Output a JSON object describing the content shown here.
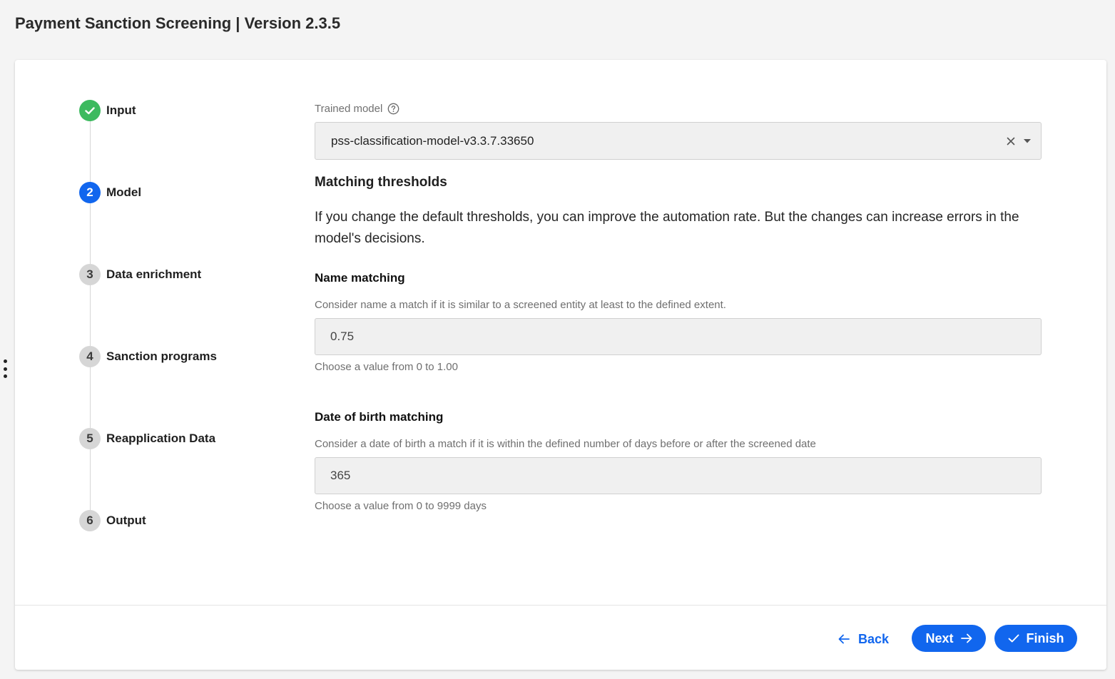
{
  "app": {
    "title": "Payment Sanction Screening | Version 2.3.5"
  },
  "steps": [
    {
      "marker": "",
      "label": "Input",
      "state": "done"
    },
    {
      "marker": "2",
      "label": "Model",
      "state": "current"
    },
    {
      "marker": "3",
      "label": "Data enrichment",
      "state": "pending"
    },
    {
      "marker": "4",
      "label": "Sanction programs",
      "state": "pending"
    },
    {
      "marker": "5",
      "label": "Reapplication Data",
      "state": "pending"
    },
    {
      "marker": "6",
      "label": "Output",
      "state": "pending"
    }
  ],
  "model": {
    "label": "Trained model",
    "value": "pss-classification-model-v3.3.7.33650"
  },
  "thresholds": {
    "title": "Matching thresholds",
    "description": "If you change the default thresholds, you can improve the automation rate. But the changes can increase errors in the model's decisions."
  },
  "name_matching": {
    "title": "Name matching",
    "description": "Consider name a match if it is similar to a screened entity at least to the defined extent.",
    "value": "0.75",
    "hint": "Choose a value from 0 to 1.00"
  },
  "dob_matching": {
    "title": "Date of birth matching",
    "description": "Consider a date of birth a match if it is within the defined number of days before or after the screened date",
    "value": "365",
    "hint": "Choose a value from 0 to 9999 days"
  },
  "footer": {
    "back_label": "Back",
    "next_label": "Next",
    "finish_label": "Finish"
  },
  "colors": {
    "primary": "#1166ee",
    "success": "#3dba5f",
    "pending": "#d6d6d6"
  }
}
